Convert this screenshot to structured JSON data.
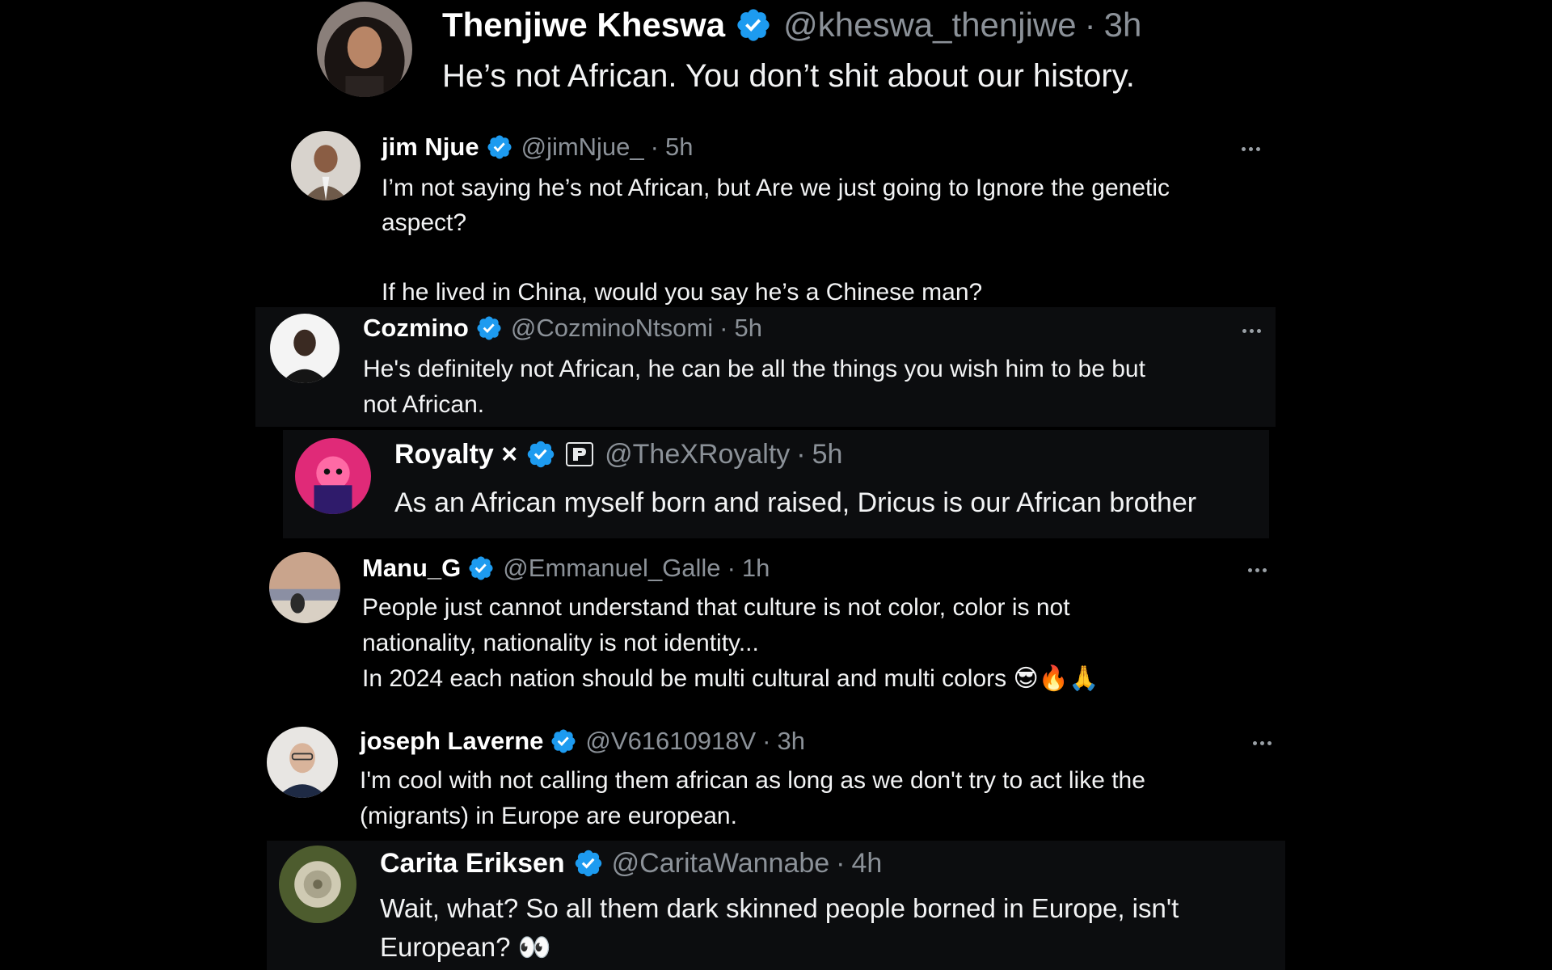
{
  "accent_color": "#1d9bf0",
  "thread": [
    {
      "id": "thenjiwe",
      "name": "Thenjiwe Kheswa",
      "handle": "@kheswa_thenjiwe",
      "separator": "·",
      "time": "3h",
      "verified": true,
      "text": "He’s not African. You don’t shit about our history."
    },
    {
      "id": "jim",
      "name": "jim Njue",
      "handle": "@jimNjue_",
      "separator": "·",
      "time": "5h",
      "verified": true,
      "text": "I’m not saying he’s not African, but Are we just going to Ignore the genetic\naspect?\n\nIf he lived in China, would you say he’s a Chinese man?"
    },
    {
      "id": "cozmino",
      "name": "Cozmino",
      "handle": "@CozminoNtsomi",
      "separator": "·",
      "time": "5h",
      "verified": true,
      "text": "He's definitely not African, he can be all the things you wish him to be but\nnot African."
    },
    {
      "id": "royalty",
      "name": "Royalty ×",
      "handle": "@TheXRoyalty",
      "separator": "·",
      "time": "5h",
      "verified": true,
      "affiliate_icon": "parler-style-affiliate-icon",
      "text": "As an African myself born and raised, Dricus is our African brother"
    },
    {
      "id": "manu",
      "name": "Manu_G",
      "handle": "@Emmanuel_Galle",
      "separator": "·",
      "time": "1h",
      "verified": true,
      "text": "People just cannot understand that culture is not color, color is not\nnationality, nationality is not identity...\nIn 2024 each nation should be multi cultural and multi colors 😎🔥🙏"
    },
    {
      "id": "joseph",
      "name": "joseph Laverne",
      "handle": "@V61610918V",
      "separator": "·",
      "time": "3h",
      "verified": true,
      "text": "I'm cool with not calling them african as long as we don't try to act like the\n(migrants) in Europe are european."
    },
    {
      "id": "carita",
      "name": "Carita Eriksen",
      "handle": "@CaritaWannabe",
      "separator": "·",
      "time": "4h",
      "verified": true,
      "text": "Wait, what? So all them dark skinned people borned in Europe, isn't\nEuropean? 👀"
    }
  ]
}
